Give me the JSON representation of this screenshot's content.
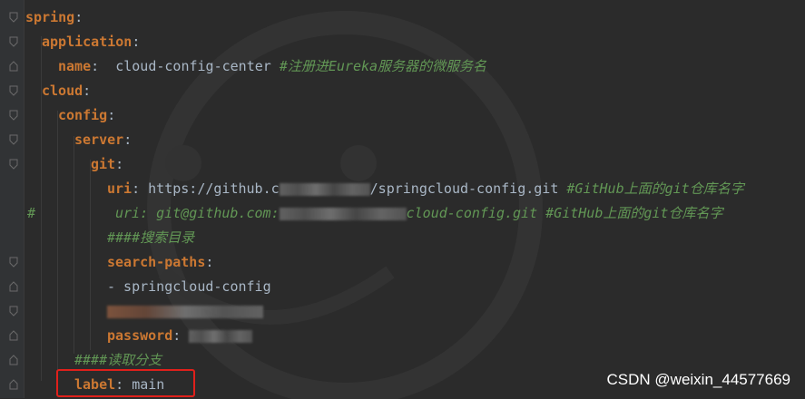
{
  "lines": {
    "l1": {
      "key": "spring",
      "sep": ":"
    },
    "l2": {
      "key": "application",
      "sep": ":"
    },
    "l3": {
      "key": "name",
      "sep": ":",
      "value": "cloud-config-center",
      "comment": "#注册进Eureka服务器的微服务名"
    },
    "l4": {
      "key": "cloud",
      "sep": ":"
    },
    "l5": {
      "key": "config",
      "sep": ":"
    },
    "l6": {
      "key": "server",
      "sep": ":"
    },
    "l7": {
      "key": "git",
      "sep": ":"
    },
    "l8": {
      "key": "uri",
      "sep": ":",
      "value_prefix": "https://github.c",
      "value_suffix": "/springcloud-config.git",
      "comment": "#GitHub上面的git仓库名字"
    },
    "l9": {
      "hash": "#",
      "text_prefix": "uri: git@github.com:",
      "text_suffix": "cloud-config.git #GitHub上面的git仓库名字"
    },
    "l10": {
      "comment": "####搜索目录"
    },
    "l11": {
      "key": "search-paths",
      "sep": ":"
    },
    "l12": {
      "value": "- springcloud-config"
    },
    "l14": {
      "key": "password",
      "sep": ":"
    },
    "l15": {
      "comment": "####读取分支"
    },
    "l16": {
      "key": "label",
      "sep": ":",
      "value": "main"
    }
  },
  "watermark": {
    "text": "CSDN @weixin_44577669"
  },
  "colors": {
    "background": "#2b2b2b",
    "key": "#cc7832",
    "comment": "#629755",
    "text": "#a9b7c6",
    "highlight": "#e0201b"
  }
}
